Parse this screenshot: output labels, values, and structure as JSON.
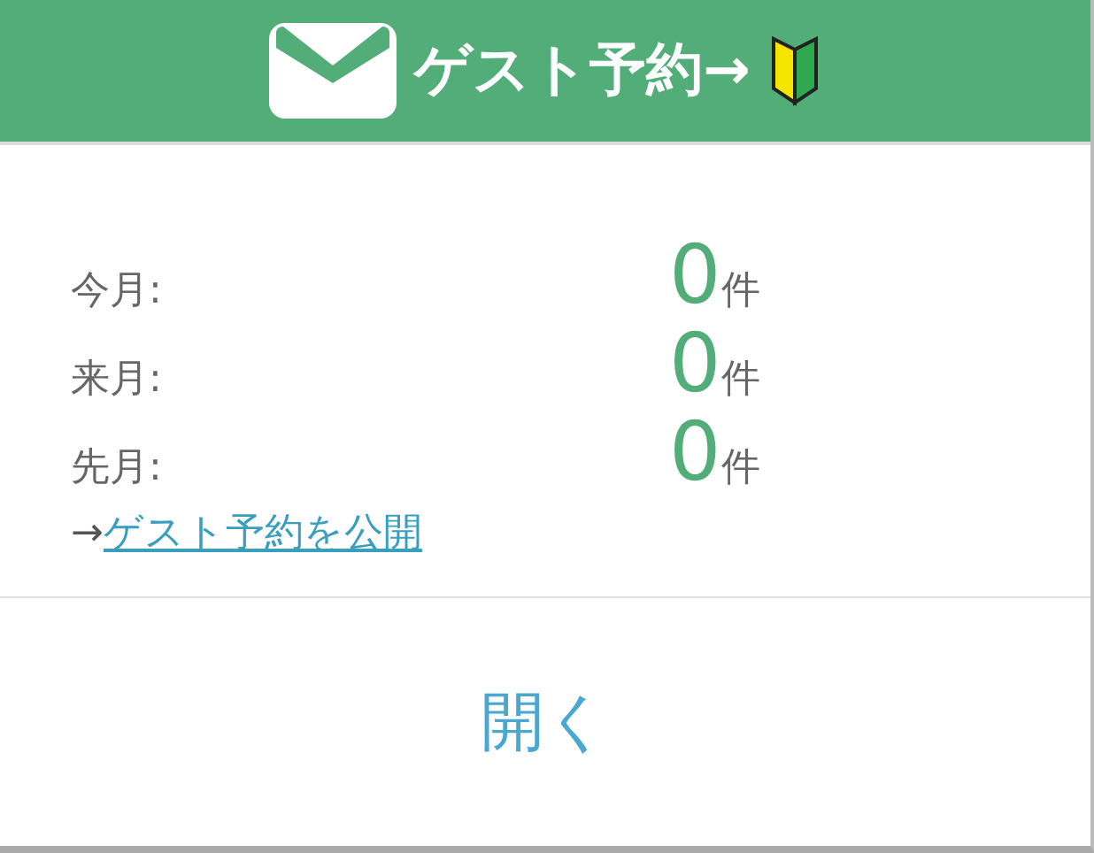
{
  "header": {
    "title": "ゲスト予約→"
  },
  "stats": [
    {
      "label": "今月:",
      "count": "0",
      "unit": "件"
    },
    {
      "label": "来月:",
      "count": "0",
      "unit": "件"
    },
    {
      "label": "先月:",
      "count": "0",
      "unit": "件"
    }
  ],
  "link": {
    "prefix": "→",
    "text": "ゲスト予約を公開"
  },
  "button": {
    "label": "開く"
  }
}
